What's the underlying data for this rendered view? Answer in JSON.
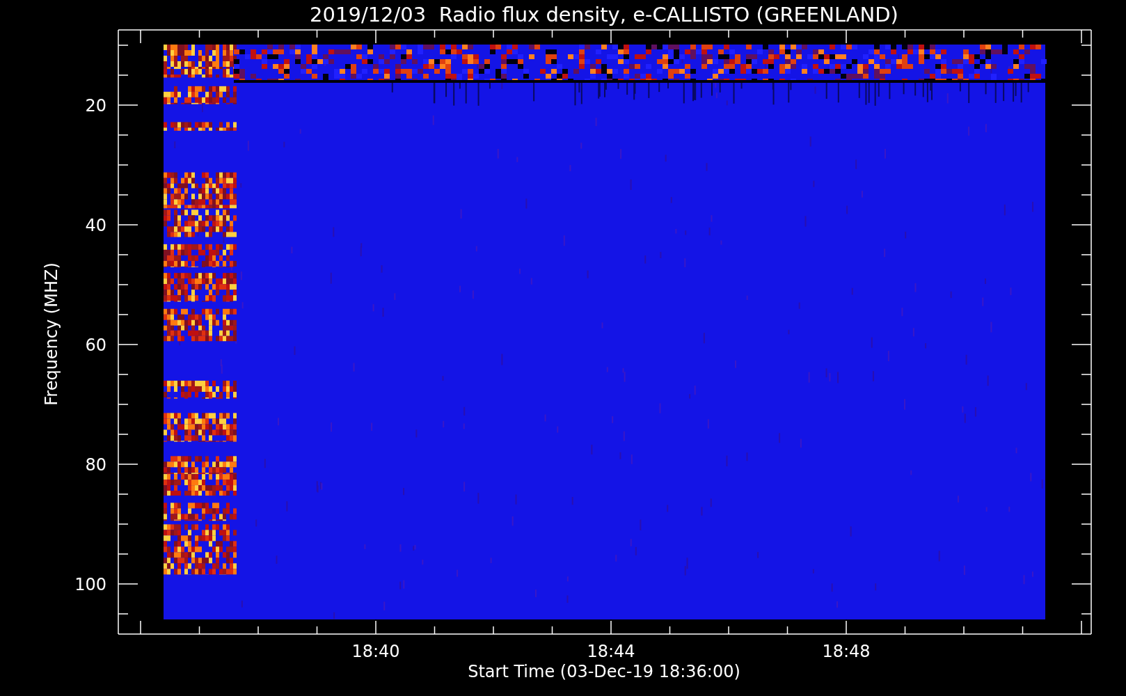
{
  "title": "2019/12/03  Radio flux density, e-CALLISTO (GREENLAND)",
  "y_axis": {
    "label": "Frequency (MHZ)",
    "ticks": [
      "20",
      "40",
      "60",
      "80",
      "100"
    ]
  },
  "x_axis": {
    "label": "Start Time (03-Dec-19 18:36:00)",
    "ticks": [
      "18:40",
      "18:44",
      "18:48"
    ]
  }
}
